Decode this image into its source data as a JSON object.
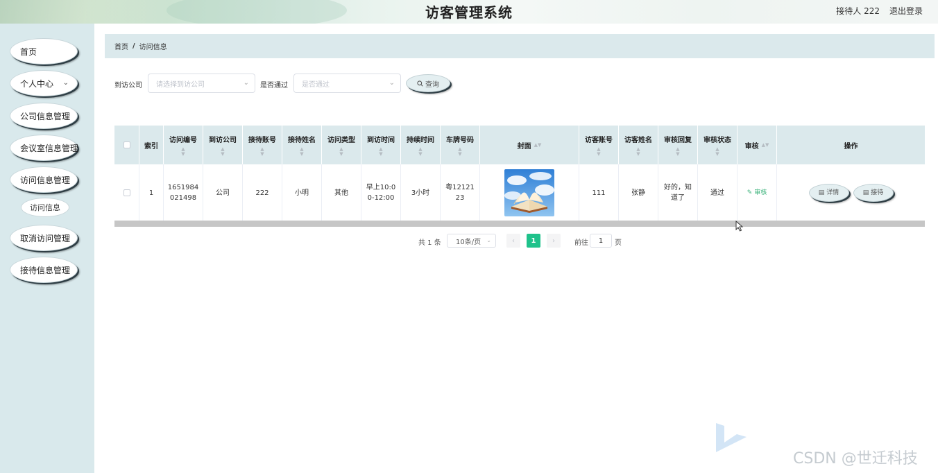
{
  "header": {
    "title": "访客管理系统",
    "user": "接待人 222",
    "logout": "退出登录"
  },
  "sidebar": {
    "items": [
      {
        "label": "首页"
      },
      {
        "label": "个人中心"
      },
      {
        "label": "公司信息管理"
      },
      {
        "label": "会议室信息管理"
      },
      {
        "label": "访问信息管理"
      },
      {
        "label": "访问信息"
      },
      {
        "label": "取消访问管理"
      },
      {
        "label": "接待信息管理"
      }
    ]
  },
  "breadcrumb": {
    "home": "首页",
    "separator": "/",
    "current": "访问信息"
  },
  "search": {
    "company_label": "到访公司",
    "company_placeholder": "请选择到访公司",
    "passed_label": "是否通过",
    "passed_placeholder": "是否通过",
    "query_label": "查询"
  },
  "table": {
    "columns": [
      "索引",
      "访问编号",
      "到访公司",
      "接待账号",
      "接待姓名",
      "访问类型",
      "到访时间",
      "持续时间",
      "车牌号码",
      "封面",
      "访客账号",
      "访客姓名",
      "审核回复",
      "审核状态",
      "审核",
      "操作"
    ],
    "rows": [
      {
        "index": "1",
        "visit_no": "1651984021498",
        "company": "公司",
        "reception_account": "222",
        "reception_name": "小明",
        "visit_type": "其他",
        "visit_time": "早上10:00-12:00",
        "duration": "3小时",
        "plate": "粤1212123",
        "visitor_account": "111",
        "visitor_name": "张静",
        "audit_reply": "好的，知道了",
        "audit_status": "通过",
        "audit_action": "审核",
        "detail_label": "详情",
        "reception_label": "接待"
      }
    ]
  },
  "pagination": {
    "total": "共 1 条",
    "page_size": "10条/页",
    "current_page": "1",
    "goto_label": "前往",
    "goto_value": "1",
    "page_unit": "页"
  },
  "watermark": "CSDN @世迁科技"
}
